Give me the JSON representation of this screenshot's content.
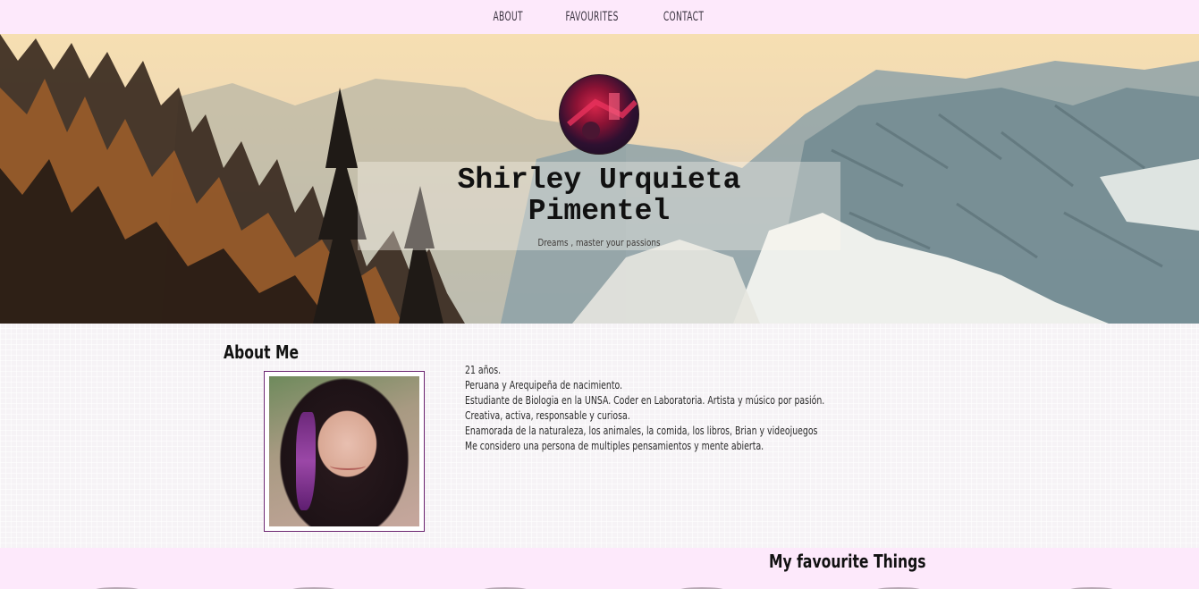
{
  "nav": {
    "items": [
      "ABOUT",
      "FAVOURITES",
      "CONTACT"
    ]
  },
  "hero": {
    "title_line1": "Shirley Urquieta",
    "title_line2": "Pimentel",
    "subtitle": "Dreams , master your passions"
  },
  "about": {
    "heading": "About Me",
    "bio": [
      "21 años.",
      "Peruana y Arequipeña de nacimiento.",
      "Estudiante de Biologia en la UNSA. Coder en Laboratoria. Artista y músico por pasión.",
      "Creativa, activa, responsable y curiosa.",
      "Enamorada de la naturaleza, los animales, la comida, los libros, Brian y videojuegos",
      "Me considero una persona de multiples pensamientos y mente abierta."
    ]
  },
  "favourites": {
    "heading": "My favourite Things"
  },
  "colors": {
    "nav_bg": "#fde9fb",
    "frame_border": "#6b2470"
  }
}
